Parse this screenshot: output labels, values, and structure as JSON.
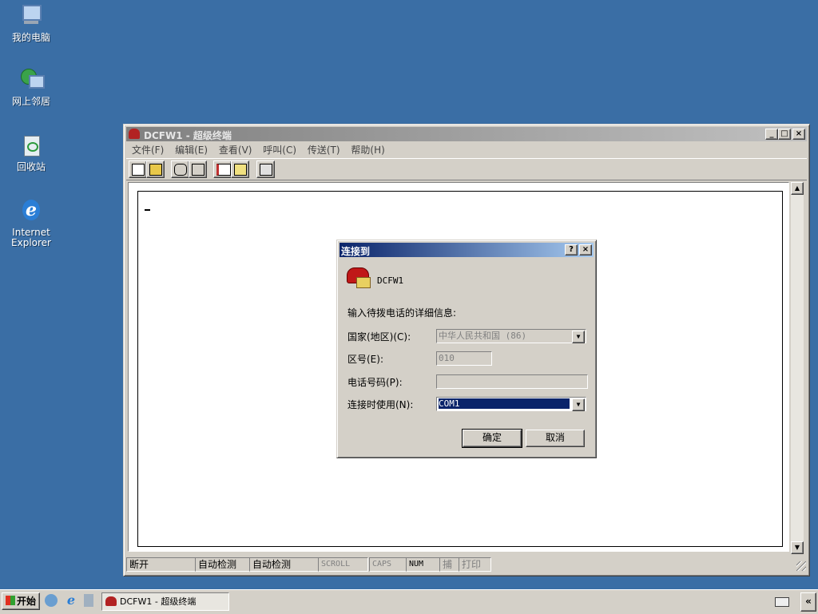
{
  "desktop": {
    "icons": [
      {
        "label": "我的电脑"
      },
      {
        "label": "网上邻居"
      },
      {
        "label": "回收站"
      },
      {
        "label": "Internet Explorer"
      }
    ]
  },
  "window": {
    "title": "DCFW1 - 超级终端",
    "menu": [
      "文件(F)",
      "编辑(E)",
      "查看(V)",
      "呼叫(C)",
      "传送(T)",
      "帮助(H)"
    ],
    "status": {
      "connection": "断开",
      "detect1": "自动检测",
      "detect2": "自动检测",
      "scroll": "SCROLL",
      "caps": "CAPS",
      "num": "NUM",
      "capture": "捕",
      "print": "打印"
    }
  },
  "dialog": {
    "title": "连接到",
    "connection_name": "DCFW1",
    "prompt": "输入待拨电话的详细信息:",
    "country_label": "国家(地区)(C):",
    "country_value": "中华人民共和国 (86)",
    "area_label": "区号(E):",
    "area_value": "010",
    "phone_label": "电话号码(P):",
    "phone_value": "",
    "connect_using_label": "连接时使用(N):",
    "connect_using_value": "COM1",
    "ok_label": "确定",
    "cancel_label": "取消"
  },
  "taskbar": {
    "start_label": "开始",
    "task_title": "DCFW1 - 超级终端",
    "tray_toggle": "«"
  },
  "colors": {
    "desktop": "#3a6ea5",
    "active_title": "#0a246a",
    "inactive_title": "#808080",
    "face": "#d4d0c8"
  }
}
